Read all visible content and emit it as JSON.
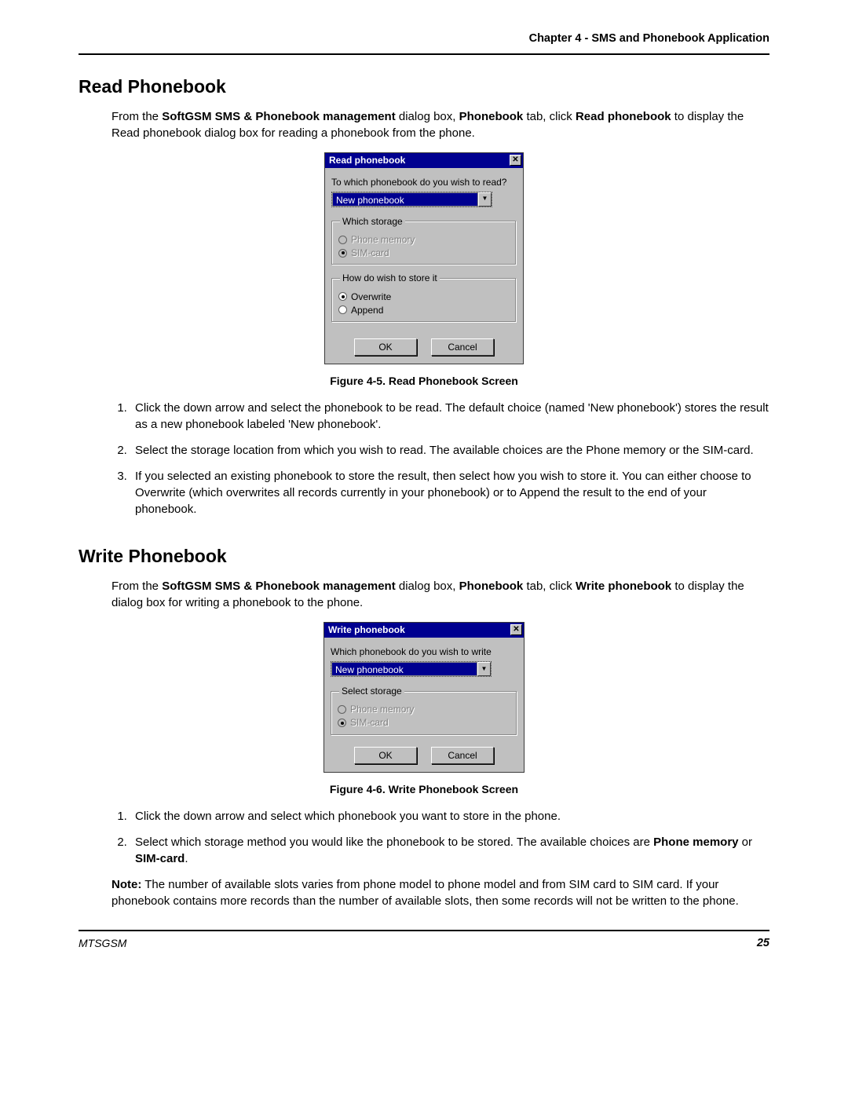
{
  "header": {
    "chapter": "Chapter 4 - SMS and Phonebook Application"
  },
  "section1": {
    "heading": "Read Phonebook",
    "intro_pre": "From the ",
    "intro_b1": "SoftGSM SMS & Phonebook management",
    "intro_mid1": " dialog box, ",
    "intro_b2": "Phonebook",
    "intro_mid2": " tab, click ",
    "intro_b3": "Read phonebook",
    "intro_post": " to display the Read phonebook dialog box for reading a phonebook from the phone.",
    "dialog": {
      "title": "Read phonebook",
      "close": "✕",
      "prompt": "To which phonebook do you wish to read?",
      "combo_value": "New phonebook",
      "arrow": "▼",
      "group1": {
        "legend": "Which storage",
        "opt1": "Phone memory",
        "opt2": "SIM-card"
      },
      "group2": {
        "legend": "How do wish to store it",
        "opt1": "Overwrite",
        "opt2": "Append"
      },
      "ok": "OK",
      "cancel": "Cancel"
    },
    "caption": "Figure 4-5.  Read Phonebook Screen",
    "list": {
      "i1": "Click the down arrow and select the phonebook to be read. The default choice (named 'New phonebook') stores the result as a new phonebook labeled 'New phonebook'.",
      "i2": "Select the storage location from which you wish to read. The available choices are the Phone memory or the SIM-card.",
      "i3": "If you selected an existing phonebook to store the result, then select how you wish to store it. You can either choose to Overwrite (which overwrites all records currently in your phonebook) or to Append the result to the end of your phonebook."
    }
  },
  "section2": {
    "heading": "Write Phonebook",
    "intro_pre": "From the ",
    "intro_b1": "SoftGSM SMS & Phonebook management",
    "intro_mid1": " dialog box, ",
    "intro_b2": "Phonebook",
    "intro_mid2": " tab, click ",
    "intro_b3": "Write phonebook",
    "intro_post": "  to display the dialog box for writing a phonebook to the phone.",
    "dialog": {
      "title": "Write phonebook",
      "close": "✕",
      "prompt": "Which phonebook do you wish to write",
      "combo_value": "New phonebook",
      "arrow": "▼",
      "group1": {
        "legend": "Select storage",
        "opt1": "Phone memory",
        "opt2": "SIM-card"
      },
      "ok": "OK",
      "cancel": "Cancel"
    },
    "caption": "Figure 4-6.  Write Phonebook Screen",
    "list": {
      "i1": "Click the down arrow and select which phonebook you want to store in the phone.",
      "i2_pre": "Select  which storage method you would like the phonebook to be stored. The available choices are ",
      "i2_b1": "Phone memory",
      "i2_mid": " or ",
      "i2_b2": "SIM-card",
      "i2_post": "."
    },
    "note_b": "Note:",
    "note": " The number of available slots varies from phone model to phone model and from SIM card to SIM card. If your phonebook contains more records than the number of available slots, then some records will not be written to the phone."
  },
  "footer": {
    "left": "MTSGSM",
    "right": "25"
  }
}
